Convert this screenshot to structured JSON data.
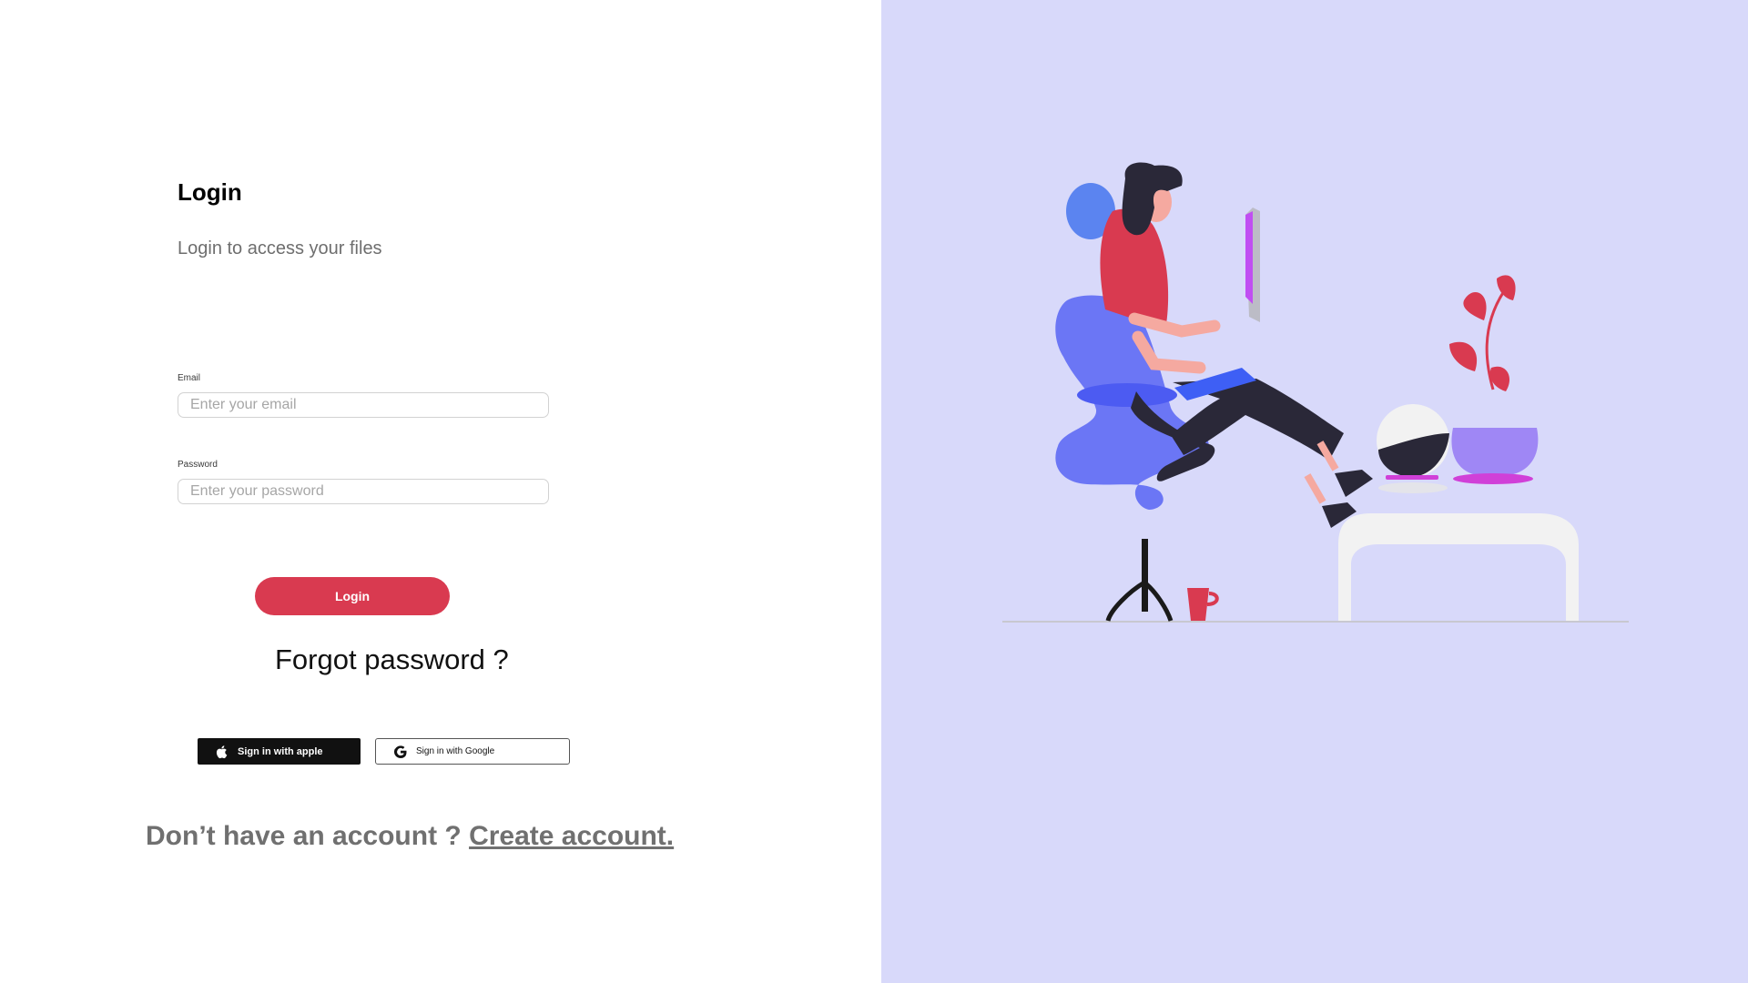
{
  "login": {
    "title": "Login",
    "subtitle": "Login to access your files",
    "email": {
      "label": "Email",
      "placeholder": "Enter your email",
      "value": ""
    },
    "password": {
      "label": "Password",
      "placeholder": "Enter your password",
      "value": ""
    },
    "login_button": "Login",
    "forgot_password": "Forgot password ?",
    "apple_button": "Sign in with apple",
    "google_button": "Sign in with Google",
    "signup_prompt": "Don’t have an account ?",
    "signup_link": "Create account."
  },
  "icons": {
    "apple": "apple-icon",
    "google": "google-icon"
  },
  "colors": {
    "accent": "#d93a50",
    "illustration_background": "#d8d9fa",
    "text_muted": "#707070"
  }
}
